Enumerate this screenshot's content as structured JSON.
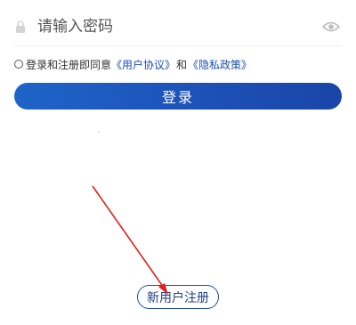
{
  "password": {
    "placeholder": "请输入密码",
    "lock_icon": "lock-icon",
    "eye_icon": "eye-icon"
  },
  "agreement": {
    "prefix": "登录和注册即同意",
    "user_agreement": "《用户协议》",
    "conjunction": "和",
    "privacy_policy": "《隐私政策》",
    "link_color": "#1d4fb0"
  },
  "login": {
    "label": "登录",
    "color": "#1d52b8"
  },
  "register": {
    "label": "新用户注册",
    "border_color": "#1f4c9c"
  },
  "annotation": {
    "arrow_color": "#e02020"
  }
}
